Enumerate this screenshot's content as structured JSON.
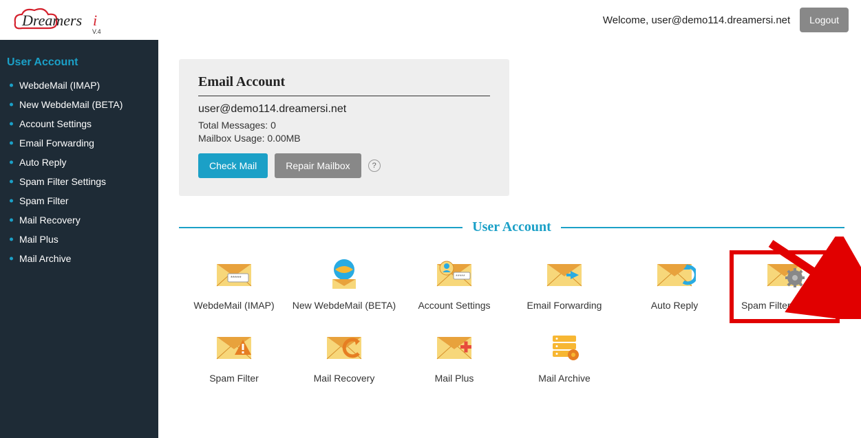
{
  "header": {
    "welcome_prefix": "Welcome, ",
    "welcome_user": "user@demo114.dreamersi.net",
    "logout_label": "Logout"
  },
  "brand": {
    "name": "Dreamersi",
    "version": "V.4"
  },
  "sidebar": {
    "title": "User Account",
    "items": [
      {
        "label": "WebdeMail (IMAP)"
      },
      {
        "label": "New WebdeMail (BETA)"
      },
      {
        "label": "Account Settings"
      },
      {
        "label": "Email Forwarding"
      },
      {
        "label": "Auto Reply"
      },
      {
        "label": "Spam Filter Settings"
      },
      {
        "label": "Spam Filter"
      },
      {
        "label": "Mail Recovery"
      },
      {
        "label": "Mail Plus"
      },
      {
        "label": "Mail Archive"
      }
    ]
  },
  "account_card": {
    "title": "Email Account",
    "email": "user@demo114.dreamersi.net",
    "total_messages_label": "Total Messages: ",
    "total_messages_value": "0",
    "usage_label": "Mailbox Usage: ",
    "usage_value": "0.00MB",
    "check_mail_label": "Check Mail",
    "repair_label": "Repair Mailbox",
    "help_glyph": "?"
  },
  "section": {
    "title": "User Account"
  },
  "tiles": [
    {
      "name": "webdemail-imap",
      "label": "WebdeMail (IMAP)",
      "icon": "envelope-password"
    },
    {
      "name": "new-webdemail-beta",
      "label": "New WebdeMail (BETA)",
      "icon": "envelope-globe"
    },
    {
      "name": "account-settings",
      "label": "Account Settings",
      "icon": "envelope-user"
    },
    {
      "name": "email-forwarding",
      "label": "Email Forwarding",
      "icon": "envelope-forward"
    },
    {
      "name": "auto-reply",
      "label": "Auto Reply",
      "icon": "envelope-reply"
    },
    {
      "name": "spam-filter-settings",
      "label": "Spam Filter Settings",
      "icon": "envelope-gear",
      "highlight": true
    },
    {
      "name": "spam-filter",
      "label": "Spam Filter",
      "icon": "envelope-warning"
    },
    {
      "name": "mail-recovery",
      "label": "Mail Recovery",
      "icon": "envelope-undo"
    },
    {
      "name": "mail-plus",
      "label": "Mail Plus",
      "icon": "envelope-plus"
    },
    {
      "name": "mail-archive",
      "label": "Mail Archive",
      "icon": "server-gear"
    }
  ],
  "colors": {
    "accent": "#1ba0c7",
    "sidebar_bg": "#1e2b36",
    "highlight": "#e10000",
    "envelope_light": "#f7d77a",
    "envelope_dark": "#e8a23c"
  }
}
